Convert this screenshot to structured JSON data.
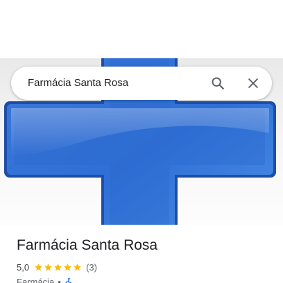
{
  "search": {
    "query": "Farmácia Santa Rosa"
  },
  "place": {
    "name": "Farmácia Santa Rosa",
    "rating": "5,0",
    "rating_value": 5.0,
    "rating_max": 5,
    "review_count": "(3)",
    "category": "Farmácia",
    "separator": "•"
  },
  "icons": {
    "search": "search-icon",
    "close": "close-icon",
    "star": "star-icon",
    "accessibility": "wheelchair-icon"
  },
  "colors": {
    "cross_blue": "#3f7fdc",
    "star_gold": "#fbbc04",
    "accessibility_blue": "#1a73e8"
  }
}
